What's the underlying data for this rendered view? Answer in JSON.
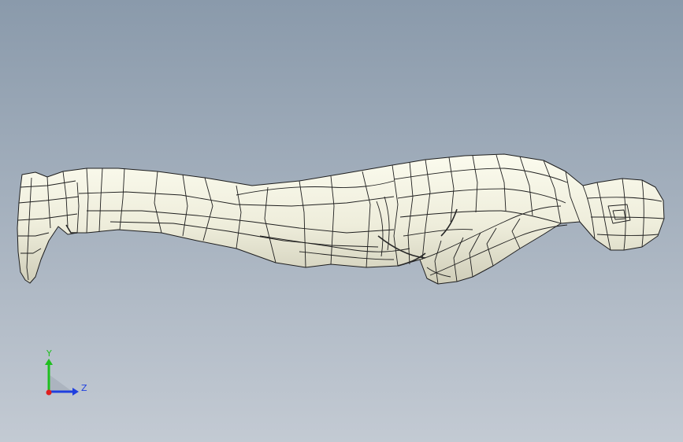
{
  "viewport": {
    "background_top": "#8a9aab",
    "background_bottom": "#c3cad3",
    "model_fill": "#f1f0df",
    "model_edge": "#1e1e1e"
  },
  "triad": {
    "y_label": "Y",
    "z_label": "Z",
    "y_color": "#1fbf1f",
    "z_color": "#1f3fdf",
    "x_color": "#df1f1f"
  }
}
